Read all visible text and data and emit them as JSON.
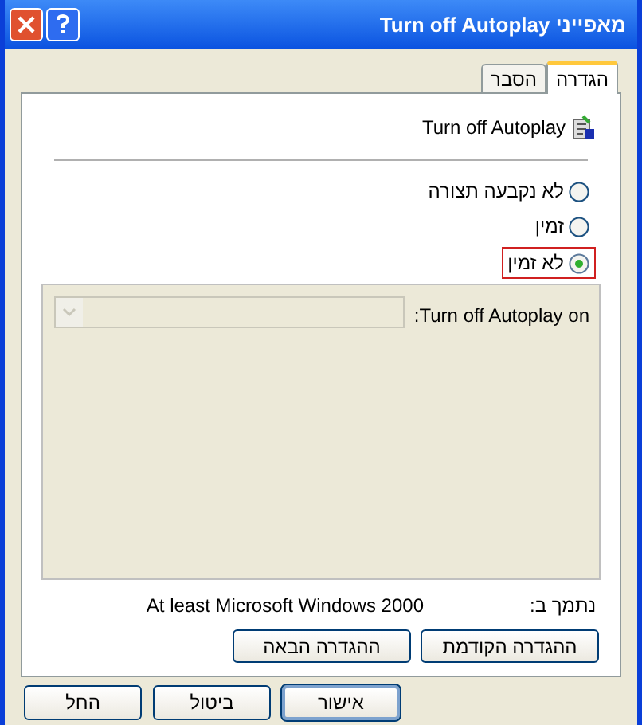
{
  "window": {
    "title": "מאפייני Turn off Autoplay"
  },
  "tabs": [
    {
      "label": "הגדרה",
      "selected": true
    },
    {
      "label": "הסבר",
      "selected": false
    }
  ],
  "setting": {
    "name": "Turn off Autoplay"
  },
  "options": [
    {
      "label": "לא נקבעה תצורה",
      "selected": false
    },
    {
      "label": "זמין",
      "selected": false
    },
    {
      "label": "לא זמין",
      "selected": true
    }
  ],
  "options_panel": {
    "label": "Turn off Autoplay on:",
    "dropdown": {
      "disabled": true
    }
  },
  "supported": {
    "label": "נתמך ב:",
    "value": "At least Microsoft Windows 2000"
  },
  "nav_buttons": [
    "ההגדרה הקודמת",
    "ההגדרה הבאה"
  ],
  "buttons": [
    {
      "label": "אישור",
      "default": true
    },
    {
      "label": "ביטול",
      "default": false
    },
    {
      "label": "החל",
      "default": false
    }
  ]
}
